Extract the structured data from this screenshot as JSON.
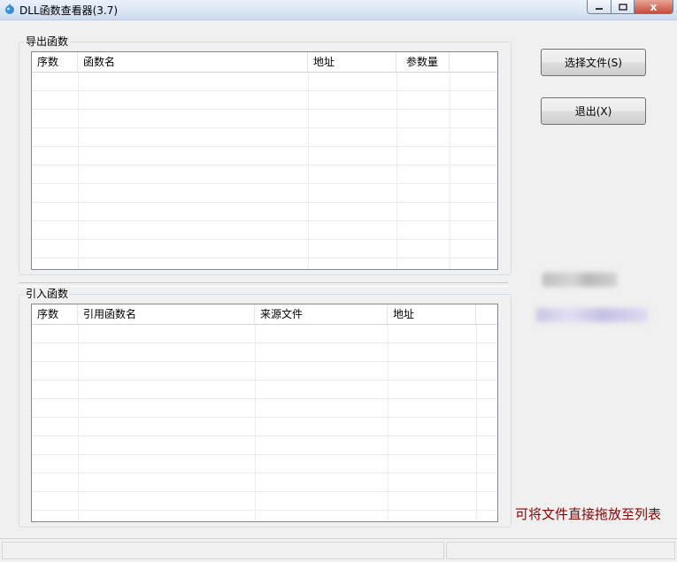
{
  "window": {
    "title": "DLL函数查看器(3.7)",
    "icon": "app-droplet-icon",
    "controls": [
      "minimize-icon",
      "maximize-icon",
      "close-icon"
    ],
    "close_glyph": "x"
  },
  "export_group": {
    "label": "导出函数",
    "columns": [
      "序数",
      "函数名",
      "地址",
      "参数量"
    ]
  },
  "import_group": {
    "label": "引入函数",
    "columns": [
      "序数",
      "引用函数名",
      "来源文件",
      "地址"
    ]
  },
  "buttons": {
    "select_file": "选择文件(S)",
    "exit": "退出(X)"
  },
  "hint": "可将文件直接拖放至列表",
  "colors": {
    "hint": "#8b0000",
    "accent": "#c74c3c"
  }
}
